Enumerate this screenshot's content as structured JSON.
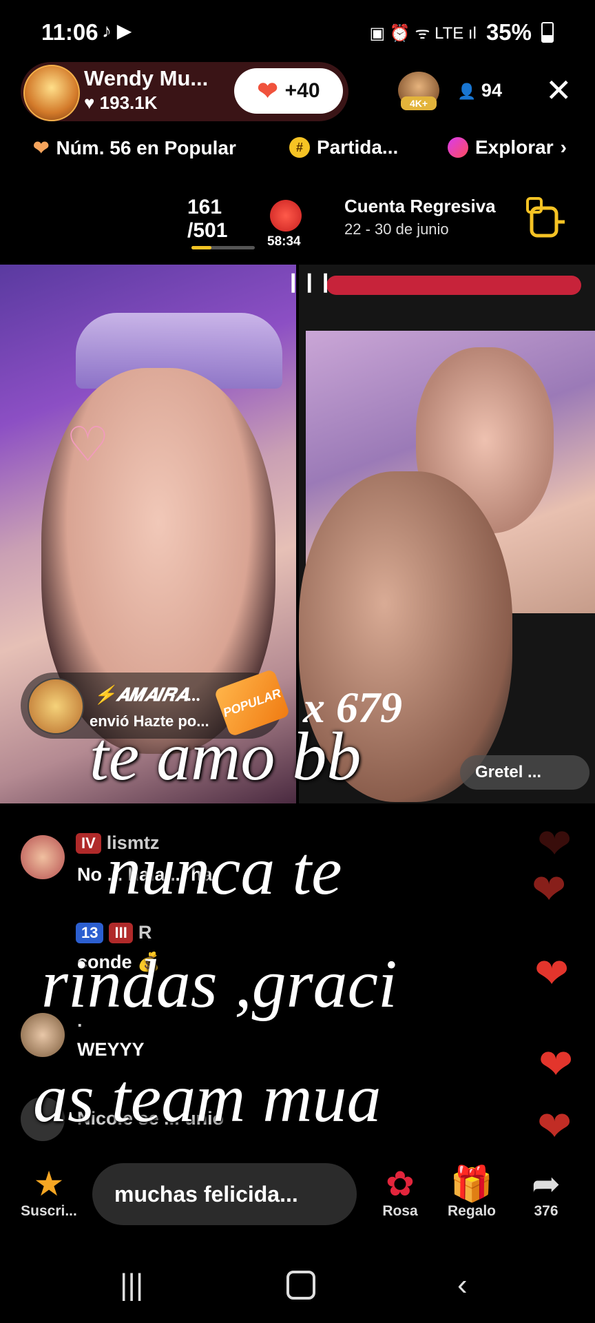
{
  "status_bar": {
    "time": "11:06",
    "apps": "♪ ▶",
    "icons": "▣ ⏰ ᯤ LTE ıl",
    "battery": "35%"
  },
  "host": {
    "name": "Wendy Mu...",
    "likes": "♥ 193.1K",
    "follow_label": "+40",
    "top_viewer_badge": "4K+",
    "viewer_count": "94"
  },
  "ranking": {
    "popular": "Núm. 56 en Popular",
    "partida": "Partida...",
    "explore": "Explorar"
  },
  "countdown": {
    "progress_top": "161",
    "progress_bottom": "/501",
    "progress_value": 0.32,
    "timer": "58:34",
    "title": "Cuenta Regresiva",
    "dates": "22 - 30 de junio"
  },
  "video": {
    "guest_name": "Gretel ..."
  },
  "gift": {
    "user": "⚡𝑨𝑴𝑨𝑰𝑹𝑨...",
    "message": "envió Hazte po...",
    "gift_label": "POPULAR",
    "count": "x 679"
  },
  "overlay": {
    "line1": "te amo bb",
    "line2": "nunca te",
    "line3": "rindas ,graci",
    "line4": "as team mua"
  },
  "comments": [
    {
      "badge1": "IV",
      "user": "lismtz",
      "text": "No ... hala ... ha"
    },
    {
      "badge1": "13",
      "badge2": "III",
      "user": "R",
      "text": "conde 💰"
    },
    {
      "user": ".",
      "text": "WEYYY"
    },
    {
      "user": "Nicole",
      "text": "se ... unió"
    }
  ],
  "bottom_bar": {
    "subscribe": "Suscri...",
    "comment_placeholder": "muchas felicida...",
    "rose": "Rosa",
    "gift": "Regalo",
    "share": "376"
  }
}
